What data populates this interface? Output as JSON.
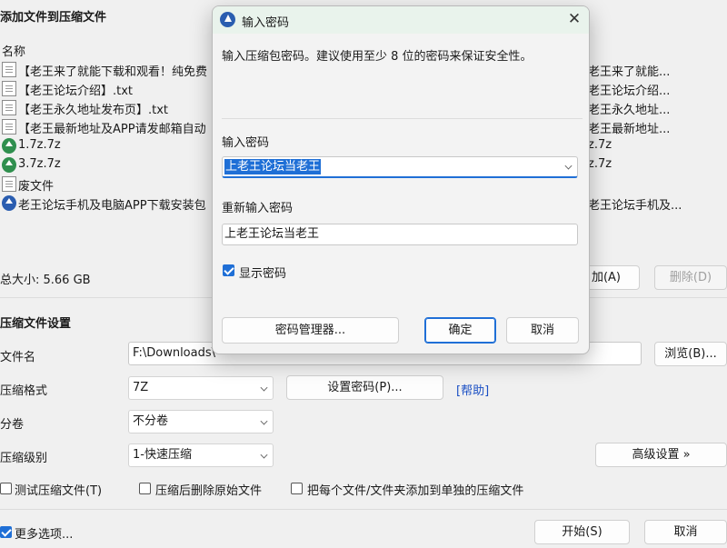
{
  "page_header": "添加文件到压缩文件",
  "file_list": {
    "column_name": "名称",
    "rows": [
      {
        "name": "【老王来了就能下载和观看！纯免费",
        "name2": "老王来了就能...",
        "icon": "document-icon"
      },
      {
        "name": "【老王论坛介绍】.txt",
        "name2": "老王论坛介绍...",
        "icon": "document-icon"
      },
      {
        "name": "【老王永久地址发布页】.txt",
        "name2": "老王永久地址...",
        "icon": "document-icon"
      },
      {
        "name": "【老王最新地址及APP请发邮箱自动",
        "name2": "老王最新地址...",
        "icon": "document-icon"
      },
      {
        "name": "1.7z.7z",
        "name2": "z.7z",
        "icon": "archive-icon"
      },
      {
        "name": "3.7z.7z",
        "name2": "z.7z",
        "icon": "archive-icon"
      },
      {
        "name": "废文件",
        "name2": "",
        "icon": "document-icon"
      },
      {
        "name": "老王论坛手机及电脑APP下载安装包",
        "name2": "老王论坛手机及...",
        "icon": "installer-icon"
      }
    ]
  },
  "summary": {
    "total_size": "总大小: 5.66 GB",
    "add_button": "加(A)",
    "delete_button": "删除(D)"
  },
  "settings": {
    "section_title": "压缩文件设置",
    "filename_label": "文件名",
    "filename_value": "F:\\Downloads\\",
    "browse_button": "浏览(B)...",
    "format_label": "压缩格式",
    "format_value": "7Z",
    "set_password_button": "设置密码(P)...",
    "help_link": "[帮助]",
    "split_label": "分卷",
    "split_value": "不分卷",
    "level_label": "压缩级别",
    "level_value": "1-快速压缩",
    "advanced_button": "高级设置 »",
    "test_checkbox": "测试压缩文件(T)",
    "delete_after_checkbox": "压缩后删除原始文件",
    "separate_checkbox": "把每个文件/文件夹添加到单独的压缩文件",
    "more_options_checkbox": "更多选项...",
    "start_button": "开始(S)",
    "cancel_button": "取消"
  },
  "dialog": {
    "title": "输入密码",
    "close_glyph": "✕",
    "description": "输入压缩包密码。建议使用至少 8 位的密码来保证安全性。",
    "password_label": "输入密码",
    "password_value": "上老王论坛当老王",
    "reenter_label": "重新输入密码",
    "reenter_value": "上老王论坛当老王",
    "show_password_label": "显示密码",
    "show_password_checked": true,
    "manager_button": "密码管理器...",
    "ok_button": "确定",
    "cancel_button": "取消"
  }
}
